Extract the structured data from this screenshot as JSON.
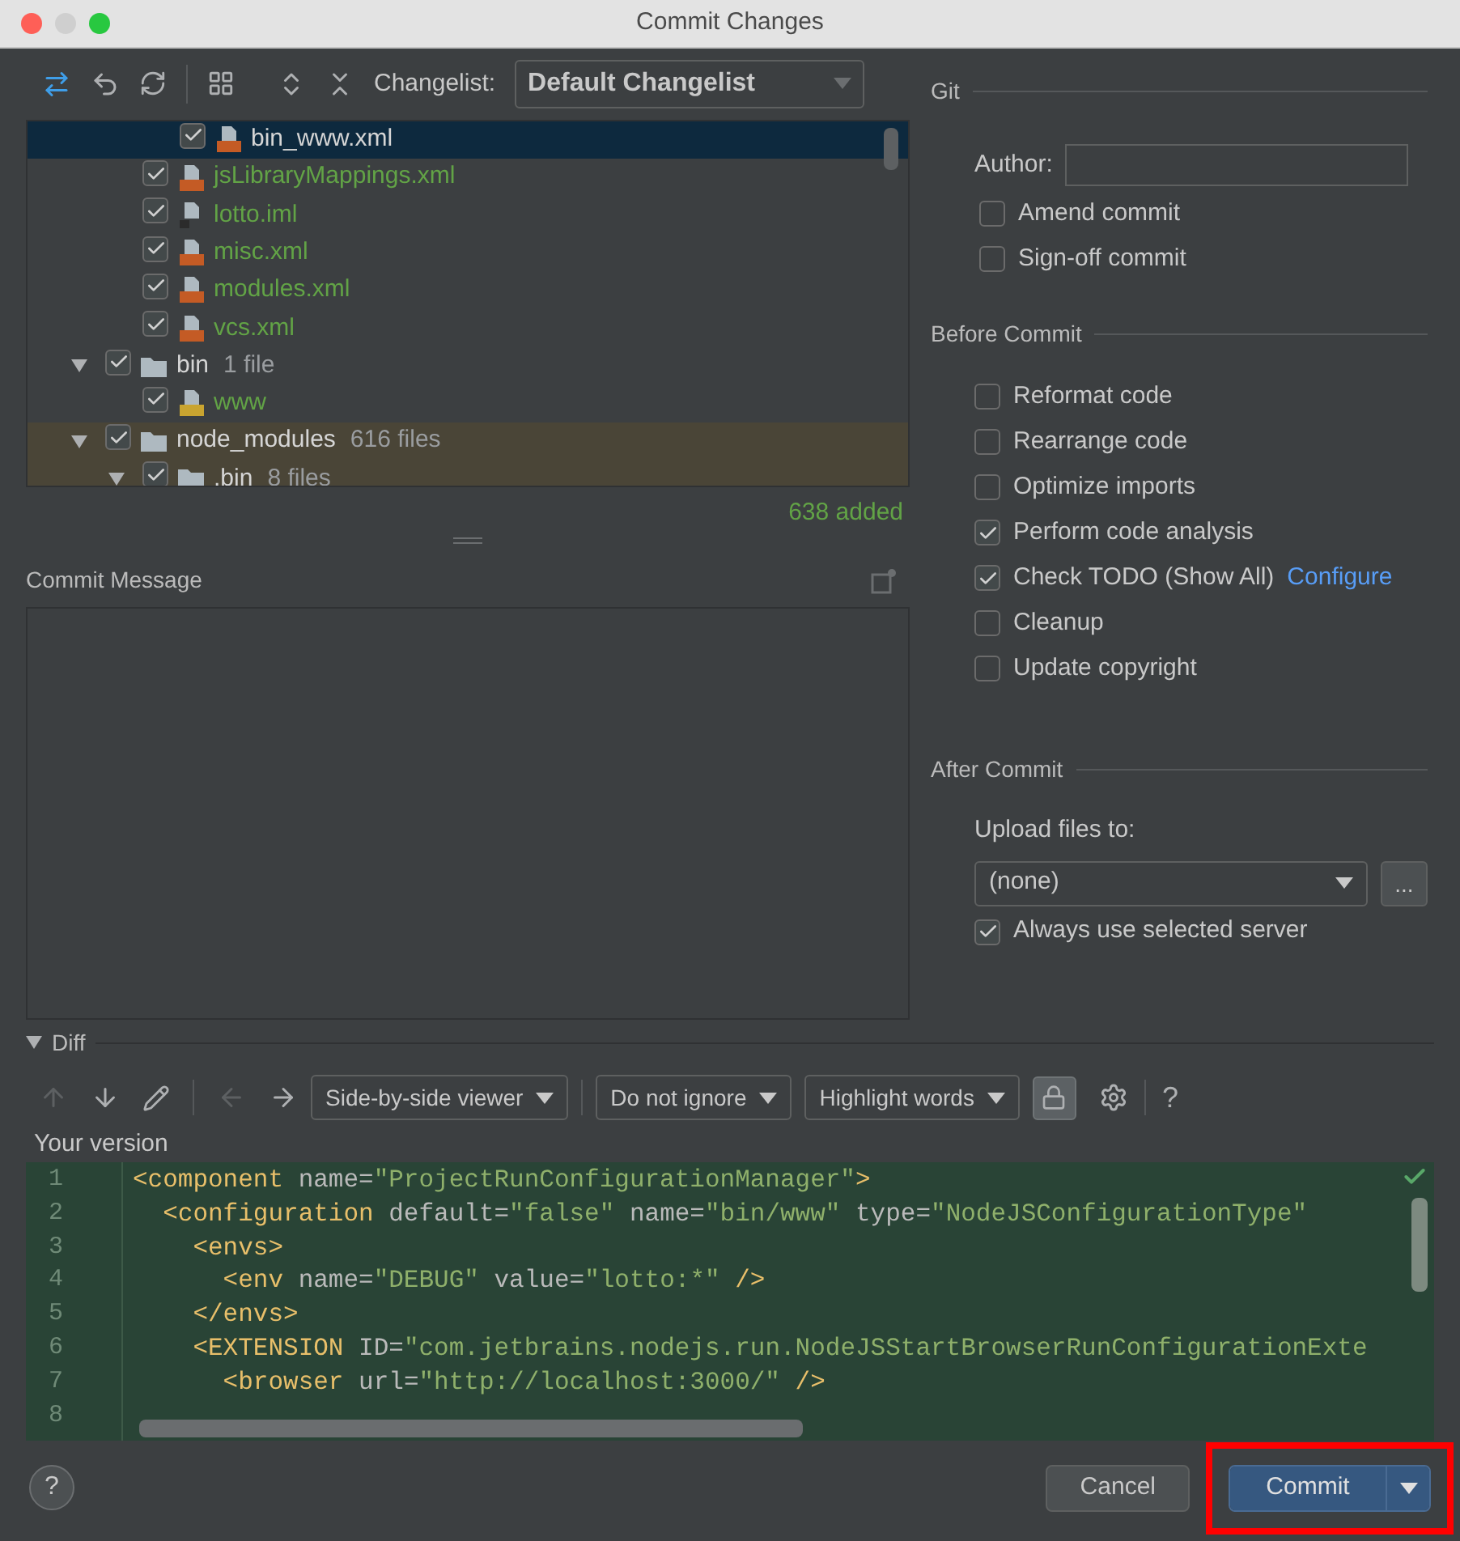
{
  "window": {
    "title": "Commit Changes"
  },
  "toolbar": {
    "changelist_label": "Changelist:",
    "changelist": "Default Changelist"
  },
  "tree": [
    {
      "children": [
        {
          "children": [
            {
              "label": "bin_www.xml",
              "kind": "xml",
              "checked": true,
              "selected": true
            }
          ]
        },
        {
          "label": "jsLibraryMappings.xml",
          "kind": "xml",
          "checked": true,
          "selected": false
        },
        {
          "label": "lotto.iml",
          "kind": "iml",
          "checked": true,
          "selected": false
        },
        {
          "label": "misc.xml",
          "kind": "xml",
          "checked": true,
          "selected": false
        },
        {
          "label": "modules.xml",
          "kind": "xml",
          "checked": true,
          "selected": false
        },
        {
          "label": "vcs.xml",
          "kind": "xml",
          "checked": true,
          "selected": false
        }
      ]
    },
    {
      "label": "bin",
      "count": "1 file",
      "kind": "folder",
      "checked": true,
      "expanded": true,
      "selected": false,
      "highlighted": false,
      "children": [
        {
          "label": "www",
          "kind": "js",
          "checked": true,
          "selected": false
        }
      ]
    },
    {
      "label": "node_modules",
      "count": "616 files",
      "kind": "folder",
      "checked": true,
      "expanded": true,
      "selected": false,
      "highlighted": true,
      "children": [
        {
          "label": ".bin",
          "count": "8 files",
          "kind": "folder",
          "checked": true,
          "expanded": true,
          "selected": false,
          "highlighted": true
        }
      ]
    }
  ],
  "summary": "638 added",
  "commit_message": {
    "label": "Commit Message"
  },
  "git": {
    "title": "Git",
    "author_label": "Author:",
    "options": [
      {
        "label": "Amend commit",
        "checked": false
      },
      {
        "label": "Sign-off commit",
        "checked": false
      }
    ]
  },
  "before_commit": {
    "title": "Before Commit",
    "options": [
      {
        "label": "Reformat code",
        "checked": false
      },
      {
        "label": "Rearrange code",
        "checked": false
      },
      {
        "label": "Optimize imports",
        "checked": false
      },
      {
        "label": "Perform code analysis",
        "checked": true
      },
      {
        "label": "Check TODO (Show All)",
        "checked": true,
        "link": "Configure"
      },
      {
        "label": "Cleanup",
        "checked": false
      },
      {
        "label": "Update copyright",
        "checked": false
      }
    ]
  },
  "after_commit": {
    "title": "After Commit",
    "upload_label": "Upload files to:",
    "server": "(none)",
    "browse": "...",
    "options": [
      {
        "label": "Always use selected server",
        "checked": true
      }
    ]
  },
  "diff": {
    "title": "Diff",
    "expanded": true,
    "viewer": "Side-by-side viewer",
    "ignore": "Do not ignore",
    "highlight": "Highlight words",
    "locked": true,
    "help": "?",
    "pane_title": "Your version",
    "lines": [
      {
        "number": "1",
        "tokens": [
          {
            "kind": "tag",
            "text": "<component"
          },
          {
            "kind": "attr",
            "text": " name="
          },
          {
            "kind": "value",
            "text": "\"ProjectRunConfigurationManager\""
          },
          {
            "kind": "tag",
            "text": ">"
          }
        ]
      },
      {
        "number": "2",
        "tokens": [
          {
            "kind": "tag",
            "text": "  <configuration"
          },
          {
            "kind": "attr",
            "text": " default="
          },
          {
            "kind": "value",
            "text": "\"false\""
          },
          {
            "kind": "attr",
            "text": " name="
          },
          {
            "kind": "value",
            "text": "\"bin/www\""
          },
          {
            "kind": "attr",
            "text": " type="
          },
          {
            "kind": "value",
            "text": "\"NodeJSConfigurationType\""
          }
        ]
      },
      {
        "number": "3",
        "tokens": [
          {
            "kind": "tag",
            "text": "    <envs>"
          }
        ]
      },
      {
        "number": "4",
        "tokens": [
          {
            "kind": "tag",
            "text": "      <env"
          },
          {
            "kind": "attr",
            "text": " name="
          },
          {
            "kind": "value",
            "text": "\"DEBUG\""
          },
          {
            "kind": "attr",
            "text": " value="
          },
          {
            "kind": "value",
            "text": "\"lotto:*\""
          },
          {
            "kind": "tag",
            "text": " />"
          }
        ]
      },
      {
        "number": "5",
        "tokens": [
          {
            "kind": "tag",
            "text": "    </envs>"
          }
        ]
      },
      {
        "number": "6",
        "tokens": [
          {
            "kind": "tag",
            "text": "    <EXTENSION"
          },
          {
            "kind": "attr",
            "text": " ID="
          },
          {
            "kind": "value",
            "text": "\"com.jetbrains.nodejs.run.NodeJSStartBrowserRunConfigurationExte"
          }
        ]
      },
      {
        "number": "7",
        "tokens": [
          {
            "kind": "tag",
            "text": "      <browser"
          },
          {
            "kind": "attr",
            "text": " url="
          },
          {
            "kind": "value",
            "text": "\"http://localhost:3000/\""
          },
          {
            "kind": "tag",
            "text": " />"
          }
        ]
      },
      {
        "number": "8"
      }
    ]
  },
  "footer": {
    "help": "?",
    "cancel": "Cancel",
    "commit": "Commit",
    "highlighted": true
  }
}
